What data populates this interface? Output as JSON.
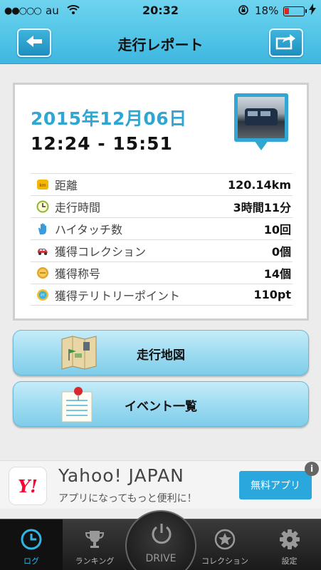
{
  "status_bar": {
    "signal": "●●○○○",
    "carrier": "au",
    "time": "20:32",
    "battery": "18%"
  },
  "header": {
    "title": "走行レポート",
    "back_icon": "arrow-left-icon",
    "share_icon": "share-icon"
  },
  "report": {
    "date": "2015年12月06日",
    "time_range": "12:24 - 15:51",
    "stats": [
      {
        "icon": "distance-icon",
        "label": "距離",
        "value": "120.14km"
      },
      {
        "icon": "clock-icon",
        "label": "走行時間",
        "value": "3時間11分"
      },
      {
        "icon": "hand-icon",
        "label": "ハイタッチ数",
        "value": "10回"
      },
      {
        "icon": "car-icon",
        "label": "獲得コレクション",
        "value": "0個"
      },
      {
        "icon": "medal-icon",
        "label": "獲得称号",
        "value": "14個"
      },
      {
        "icon": "point-icon",
        "label": "獲得テリトリーポイント",
        "value": "110pt"
      }
    ]
  },
  "buttons": {
    "map": "走行地図",
    "events": "イベント一覧"
  },
  "ad": {
    "logo_text": "Y!",
    "name": "Yahoo! JAPAN",
    "tagline": "アプリになってもっと便利に！",
    "cta": "無料アプリ",
    "info": "i"
  },
  "tabs": [
    {
      "label": "ログ",
      "icon": "clock-icon",
      "active": true
    },
    {
      "label": "ランキング",
      "icon": "trophy-icon",
      "active": false
    },
    {
      "label": "DRIVE",
      "icon": "power-icon",
      "active": false
    },
    {
      "label": "コレクション",
      "icon": "star-icon",
      "active": false
    },
    {
      "label": "設定",
      "icon": "gear-icon",
      "active": false
    }
  ],
  "colors": {
    "accent": "#2fa7d2",
    "header": "#5ccbea",
    "battery_low": "#e0241b",
    "ad_cta": "#2aa7dc"
  }
}
